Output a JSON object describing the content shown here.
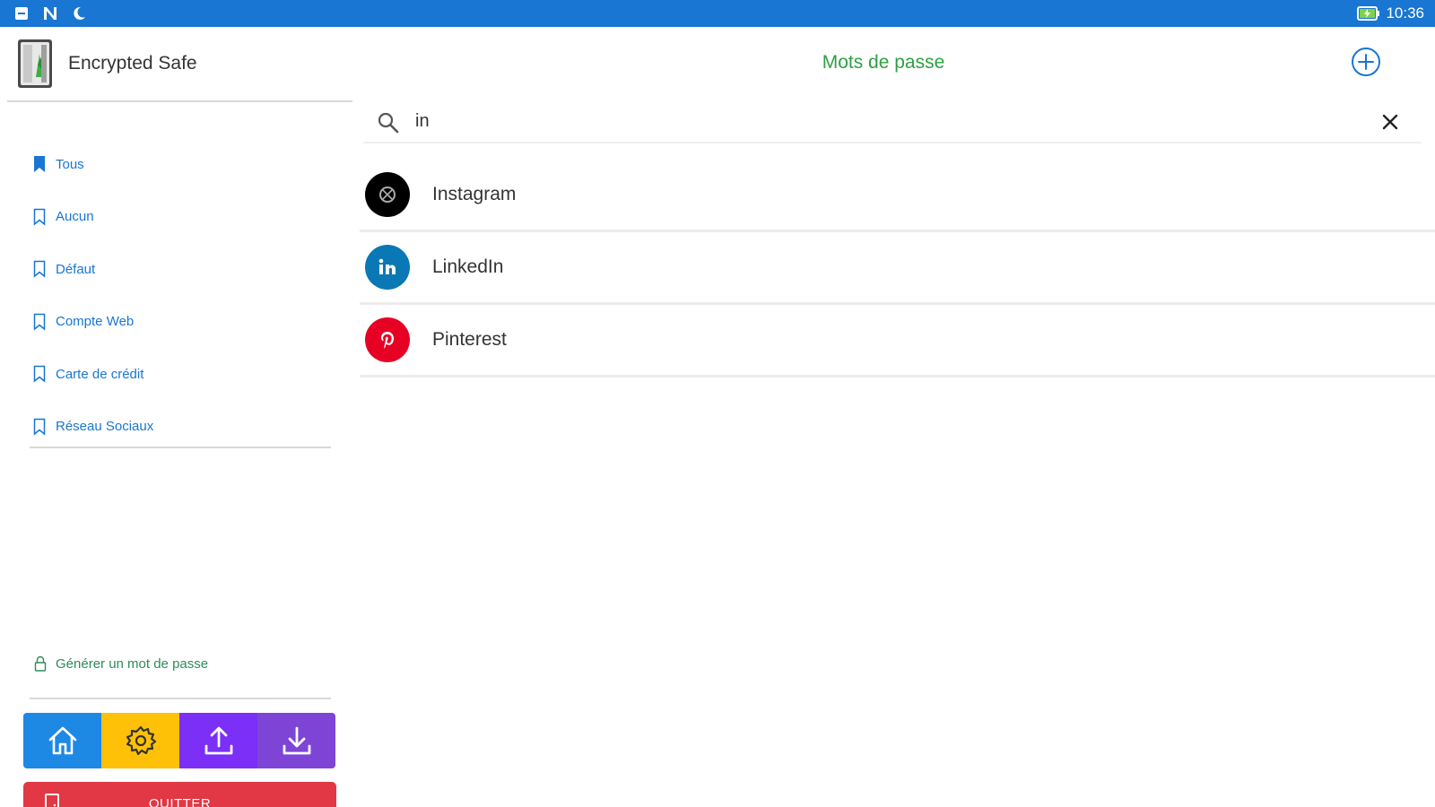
{
  "status_bar": {
    "time": "10:36",
    "left_icons": [
      "notification-icon",
      "n-icon",
      "moon-icon"
    ],
    "battery_icon": "battery-charging-icon",
    "background": "#1976d2"
  },
  "sidebar": {
    "app_name": "Encrypted Safe",
    "categories": [
      {
        "label": "Tous",
        "icon": "bookmark-filled-icon",
        "selected": true
      },
      {
        "label": "Aucun",
        "icon": "bookmark-outline-icon",
        "selected": false
      },
      {
        "label": "Défaut",
        "icon": "bookmark-outline-icon",
        "selected": false
      },
      {
        "label": "Compte Web",
        "icon": "bookmark-outline-icon",
        "selected": false
      },
      {
        "label": "Carte de crédit",
        "icon": "bookmark-outline-icon",
        "selected": false
      },
      {
        "label": "Réseau Sociaux",
        "icon": "bookmark-outline-icon",
        "selected": false
      }
    ],
    "generate_label": "Générer un mot de passe",
    "actions": [
      {
        "name": "home",
        "icon": "home-icon",
        "color": "#1e88e5"
      },
      {
        "name": "settings",
        "icon": "gear-icon",
        "color": "#ffc107"
      },
      {
        "name": "upload",
        "icon": "upload-icon",
        "color": "#7b2ff7"
      },
      {
        "name": "download",
        "icon": "download-icon",
        "color": "#7e44d6"
      }
    ],
    "quit_label": "QUITTER",
    "quit_color": "#e23744"
  },
  "main": {
    "title": "Mots de passe",
    "title_color": "#2ea043",
    "search": {
      "value": "in",
      "placeholder": ""
    },
    "entries": [
      {
        "label": "Instagram",
        "icon": "instagram-icon",
        "color": "#000000"
      },
      {
        "label": "LinkedIn",
        "icon": "linkedin-icon",
        "color": "#0a78b5"
      },
      {
        "label": "Pinterest",
        "icon": "pinterest-icon",
        "color": "#e60023"
      }
    ]
  }
}
